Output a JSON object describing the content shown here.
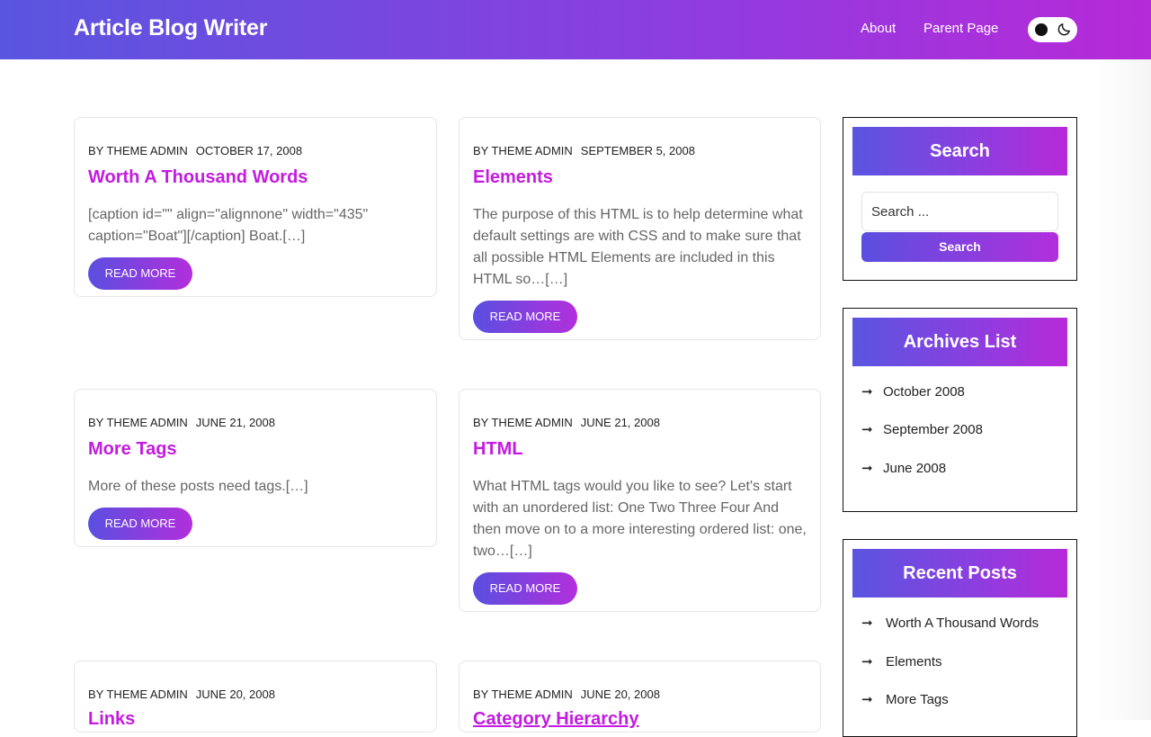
{
  "header": {
    "site_title": "Article Blog Writer",
    "nav": [
      "About",
      "Parent Page"
    ],
    "theme_toggle_icon": "moon-icon"
  },
  "posts": [
    {
      "author": "BY THEME ADMIN",
      "date": "OCTOBER 17, 2008",
      "title": "Worth A Thousand Words",
      "excerpt": "[caption id=\"\" align=\"alignnone\" width=\"435\" caption=\"Boat\"][/caption] Boat.[…]",
      "read_more": "READ MORE"
    },
    {
      "author": "BY THEME ADMIN",
      "date": "SEPTEMBER 5, 2008",
      "title": "Elements",
      "excerpt": "The purpose of this HTML is to help determine what default settings are with CSS and to make sure that all possible HTML Elements are included in this HTML so…[…]",
      "read_more": "READ MORE"
    },
    {
      "author": "BY THEME ADMIN",
      "date": "JUNE 21, 2008",
      "title": "More Tags",
      "excerpt": "More of these posts need tags.[…]",
      "read_more": "READ MORE"
    },
    {
      "author": "BY THEME ADMIN",
      "date": "JUNE 21, 2008",
      "title": "HTML",
      "excerpt": "What HTML tags would you like to see? Let's start with an unordered list: One Two Three Four And then move on to a more interesting ordered list: one, two…[…]",
      "read_more": "READ MORE"
    },
    {
      "author": "BY THEME ADMIN",
      "date": "JUNE 20, 2008",
      "title": "Links",
      "excerpt": "",
      "read_more": ""
    },
    {
      "author": "BY THEME ADMIN",
      "date": "JUNE 20, 2008",
      "title": "Category Hierarchy",
      "excerpt": "",
      "read_more": ""
    }
  ],
  "sidebar": {
    "search": {
      "title": "Search",
      "placeholder": "Search ...",
      "button_label": "Search"
    },
    "archives": {
      "title": "Archives List",
      "items": [
        "October 2008",
        "September 2008",
        "June 2008"
      ]
    },
    "recent_posts": {
      "title": "Recent Posts",
      "items": [
        "Worth A Thousand Words",
        "Elements",
        "More Tags"
      ]
    }
  },
  "colors": {
    "accent_title": "#c31be0",
    "gradient_start": "#5a55e0",
    "gradient_end": "#b62ad8"
  }
}
